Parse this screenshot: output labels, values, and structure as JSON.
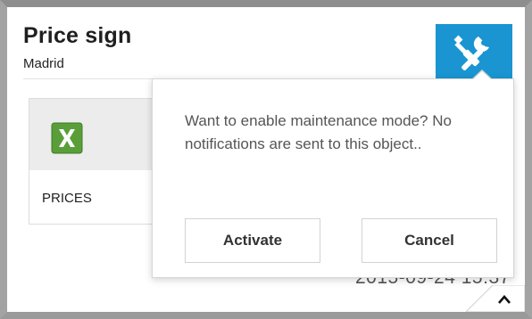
{
  "card": {
    "title": "Price sign",
    "subtitle": "Madrid",
    "timestamp": "2015-09-24 15:37"
  },
  "file": {
    "label": "PRICES",
    "icon": "excel-file-icon",
    "icon_color": "#5a9e3a"
  },
  "header": {
    "tools_icon": "tools-icon",
    "accent": "#1a95d2"
  },
  "dialog": {
    "message": "Want to enable maintenance mode? No notifications are sent to this object..",
    "activate_label": "Activate",
    "cancel_label": "Cancel"
  },
  "footer": {
    "expand_icon": "chevron-up-icon"
  }
}
